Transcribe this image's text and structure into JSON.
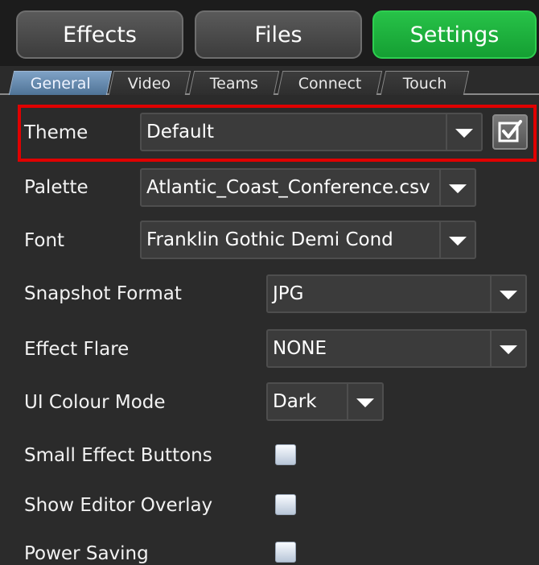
{
  "top_nav": {
    "effects": "Effects",
    "files": "Files",
    "settings": "Settings"
  },
  "tabs": [
    "General",
    "Video",
    "Teams",
    "Connect",
    "Touch"
  ],
  "settings": {
    "theme": {
      "label": "Theme",
      "value": "Default",
      "applied": true
    },
    "palette": {
      "label": "Palette",
      "value": "Atlantic_Coast_Conference.csv"
    },
    "font": {
      "label": "Font",
      "value": "Franklin Gothic Demi Cond"
    },
    "snapshot_format": {
      "label": "Snapshot Format",
      "value": "JPG"
    },
    "effect_flare": {
      "label": "Effect Flare",
      "value": "NONE"
    },
    "ui_colour_mode": {
      "label": "UI Colour Mode",
      "value": "Dark"
    },
    "small_effect_buttons": {
      "label": "Small Effect Buttons",
      "checked": false
    },
    "show_editor_overlay": {
      "label": "Show Editor Overlay",
      "checked": false
    },
    "power_saving": {
      "label": "Power Saving",
      "checked": false
    }
  },
  "colors": {
    "active_tab": "#6b8fb3",
    "active_nav": "#1fb03e",
    "highlight": "#e00000",
    "background": "#2b2b2b"
  }
}
